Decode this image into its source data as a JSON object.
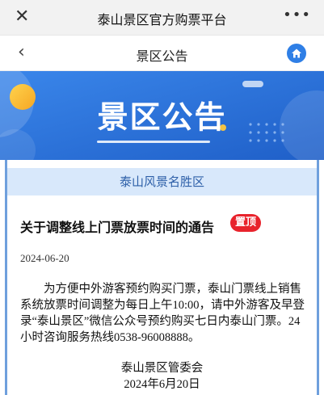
{
  "topbar": {
    "close_icon": "close-icon",
    "title": "泰山景区官方购票平台",
    "more_icon": "more-icon"
  },
  "nav": {
    "back_icon": "chevron-left-icon",
    "title": "景区公告",
    "home_icon": "home-icon"
  },
  "banner": {
    "title": "景区公告"
  },
  "notice": {
    "scenic_area": "泰山风景名胜区",
    "title": "关于调整线上门票放票时间的通告",
    "pin_badge": "置顶",
    "date": "2024-06-20",
    "body": "为方便中外游客预约购买门票，泰山门票线上销售系统放票时间调整为每日上午10:00，请中外游客及早登录“泰山景区”微信公众号预约购买七日内泰山门票。24小时咨询服务热线0538-96008888。",
    "signature_org": "泰山景区管委会",
    "signature_date": "2024年6月20日"
  },
  "colors": {
    "brand_blue": "#2a6fd6",
    "pin_red": "#e8232c",
    "subhead_bg": "#d8e8fb"
  }
}
